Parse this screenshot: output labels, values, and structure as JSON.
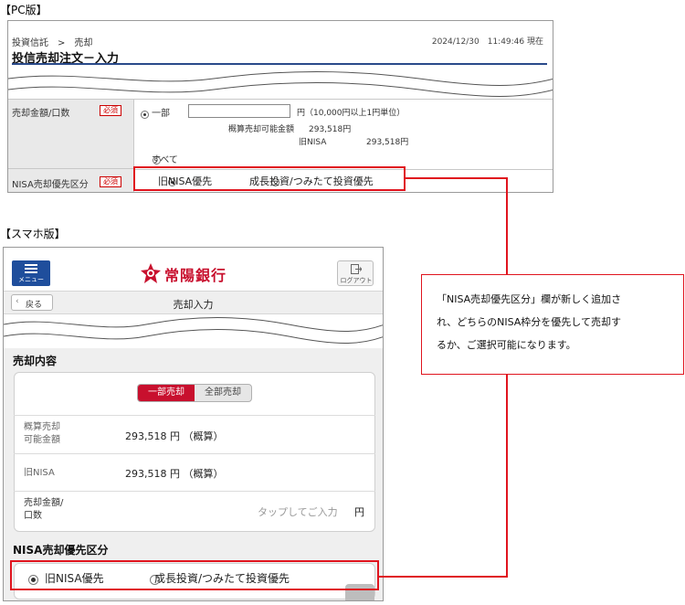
{
  "pc": {
    "section_label": "【PC版】",
    "breadcrumb": "投資信託　>　売却",
    "timestamp": "2024/12/30　11:49:46 現在",
    "title": "投信売却注文－入力",
    "amount_label": "売却金額/口数",
    "required": "必須",
    "option_partial": "一部",
    "yen_hint": "円（10,000円以上1円単位）",
    "estimated_label": "概算売却可能金額",
    "estimated_value": "293,518円",
    "old_nisa_label": "旧NISA",
    "old_nisa_value": "293,518円",
    "option_all": "すべて",
    "priority_label": "NISA売却優先区分",
    "priority_options": [
      "旧NISA優先",
      "成長投資/つみたて投資優先"
    ]
  },
  "sp": {
    "section_label": "【スマホ版】",
    "menu_label": "メニュー",
    "logo_text": "常陽銀行",
    "logout_label": "ログアウト",
    "back_label": "戻る",
    "nav_title": "売却入力",
    "content_title": "売却内容",
    "seg_partial": "一部売却",
    "seg_all": "全部売却",
    "est_label_1": "概算売却",
    "est_label_2": "可能金額",
    "est_value": "293,518 円 （概算）",
    "old_nisa_label": "旧NISA",
    "old_nisa_value": "293,518 円 （概算）",
    "amount_label_1": "売却金額/",
    "amount_label_2": "口数",
    "amount_placeholder": "タップしてご入力",
    "amount_unit": "円",
    "priority_title": "NISA売却優先区分",
    "priority_options": [
      "旧NISA優先",
      "成長投資/つみたて投資優先"
    ]
  },
  "callout": {
    "lines": [
      "「NISA売却優先区分」欄が新しく追加さ",
      "れ、どちらのNISA枠分を優先して売却す",
      "るか、ご選択可能になります。"
    ]
  },
  "colors": {
    "accent_red": "#e0141e",
    "brand_red": "#c8102e",
    "menu_blue": "#1f4e9c"
  }
}
